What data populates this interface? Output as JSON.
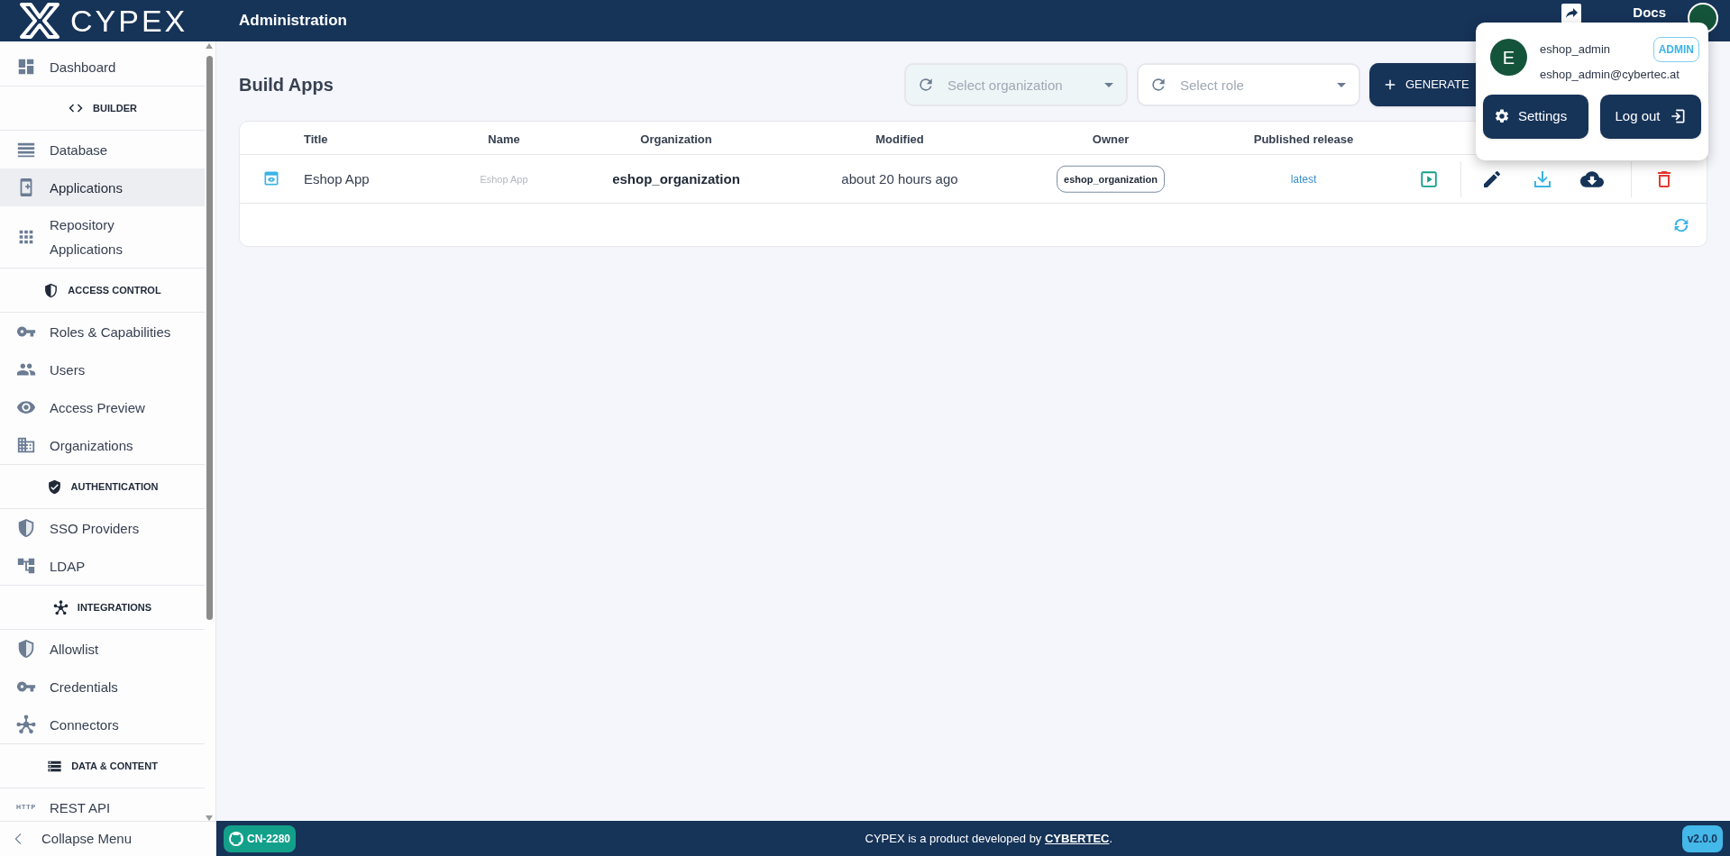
{
  "header": {
    "logo": "CYPEX",
    "title": "Administration",
    "docs": "Docs"
  },
  "sidebar": {
    "items": [
      {
        "kind": "item",
        "label": "Dashboard",
        "selected": false
      },
      {
        "kind": "section",
        "label": "BUILDER"
      },
      {
        "kind": "item",
        "label": "Database",
        "selected": false
      },
      {
        "kind": "item",
        "label": "Applications",
        "selected": true
      },
      {
        "kind": "item",
        "label": "Repository Applications",
        "selected": false
      },
      {
        "kind": "section",
        "label": "ACCESS CONTROL"
      },
      {
        "kind": "item",
        "label": "Roles & Capabilities",
        "selected": false
      },
      {
        "kind": "item",
        "label": "Users",
        "selected": false
      },
      {
        "kind": "item",
        "label": "Access Preview",
        "selected": false
      },
      {
        "kind": "item",
        "label": "Organizations",
        "selected": false
      },
      {
        "kind": "section",
        "label": "AUTHENTICATION"
      },
      {
        "kind": "item",
        "label": "SSO Providers",
        "selected": false
      },
      {
        "kind": "item",
        "label": "LDAP",
        "selected": false
      },
      {
        "kind": "section",
        "label": "INTEGRATIONS"
      },
      {
        "kind": "item",
        "label": "Allowlist",
        "selected": false
      },
      {
        "kind": "item",
        "label": "Credentials",
        "selected": false
      },
      {
        "kind": "item",
        "label": "Connectors",
        "selected": false
      },
      {
        "kind": "section",
        "label": "DATA & CONTENT"
      },
      {
        "kind": "item",
        "label": "REST API",
        "icon_text": "HTTP",
        "selected": false
      }
    ],
    "collapse": "Collapse Menu"
  },
  "page": {
    "title": "Build Apps",
    "filters": [
      {
        "placeholder": "Select organization"
      },
      {
        "placeholder": "Select role"
      }
    ],
    "generate_button": "GENERATE"
  },
  "table": {
    "columns": [
      "Title",
      "Name",
      "Organization",
      "Modified",
      "Owner",
      "Published release"
    ],
    "rows": [
      {
        "title": "Eshop App",
        "name": "Eshop App",
        "organization": "eshop_organization",
        "modified": "about 20 hours ago",
        "owner": "eshop_organization",
        "published_release": "latest"
      }
    ]
  },
  "user_menu": {
    "avatar_initial": "E",
    "username": "eshop_admin",
    "role": "ADMIN",
    "email": "eshop_admin@cybertec.at",
    "buttons": [
      "Settings",
      "Log out"
    ]
  },
  "footer": {
    "branch": "CN-2280",
    "credit": "CYPEX is a product developed by **CYBERTEC**.",
    "version": "v2.0.0"
  }
}
